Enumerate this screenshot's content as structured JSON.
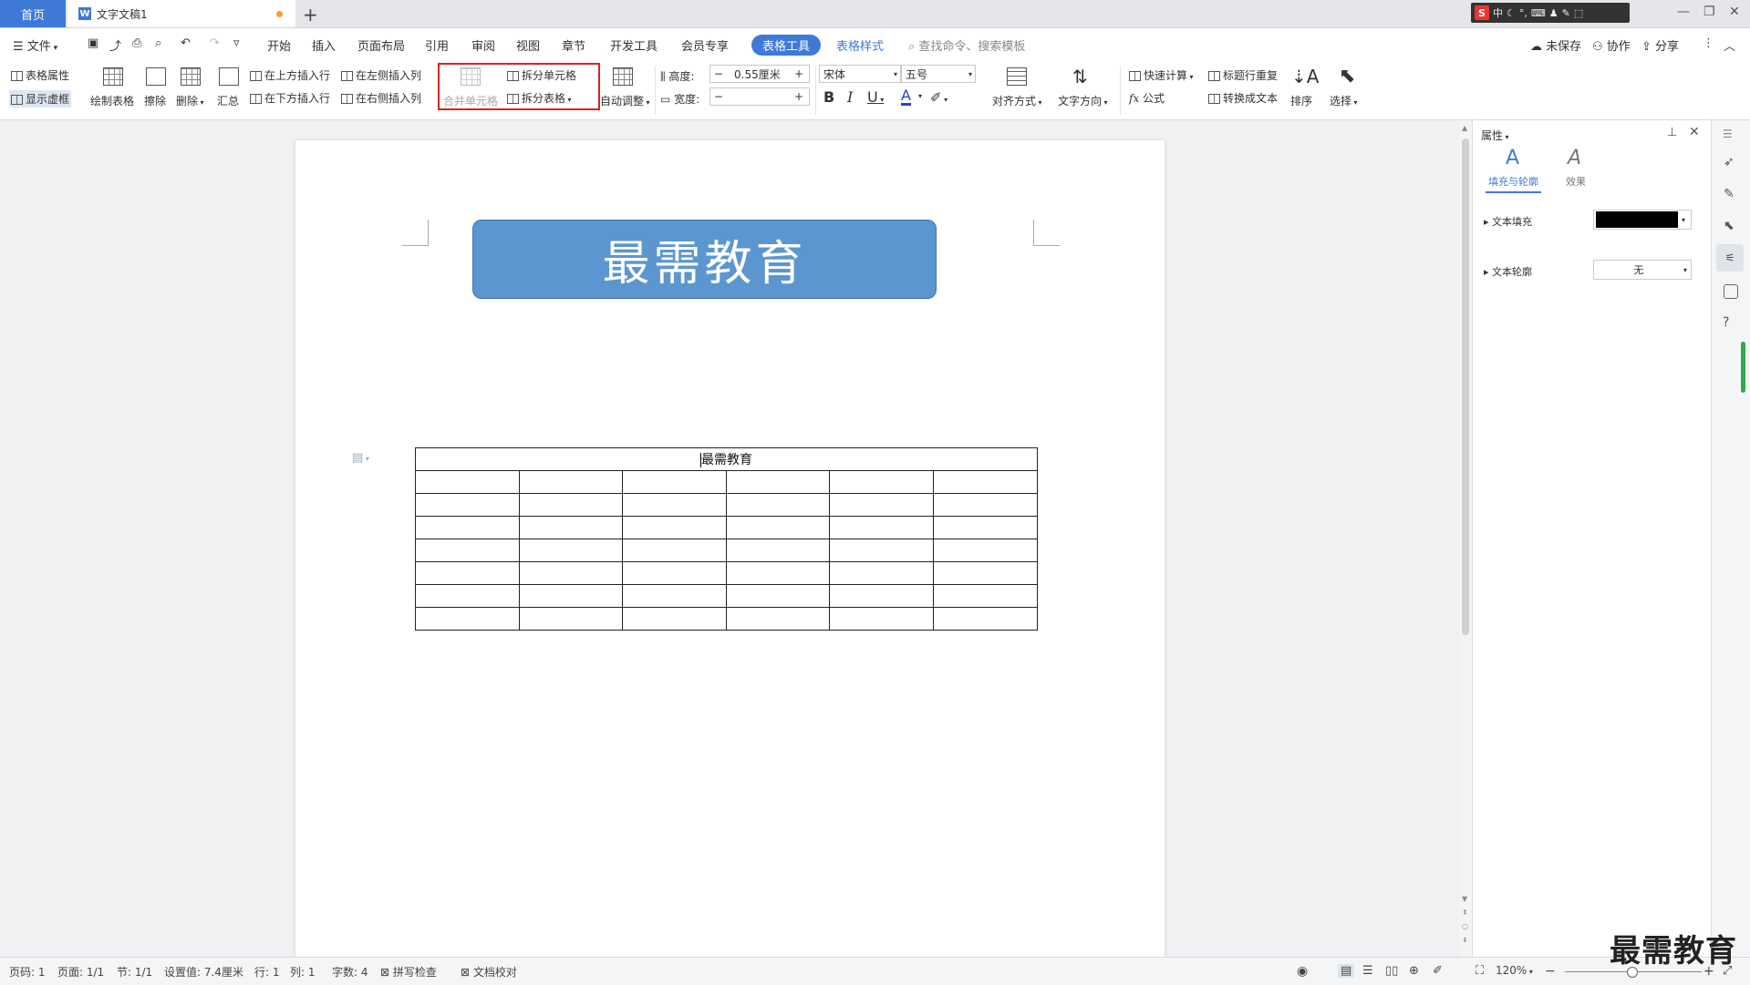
{
  "tabs": {
    "home": "首页",
    "doc_title": "文字文稿1",
    "new_tab": "+"
  },
  "ime": {
    "logo": "S",
    "mode": "中"
  },
  "window": {
    "minimize": "—",
    "restore": "❐",
    "close": "✕"
  },
  "menu": {
    "file": "文件",
    "items": [
      "开始",
      "插入",
      "页面布局",
      "引用",
      "审阅",
      "视图",
      "章节",
      "开发工具",
      "会员专享"
    ],
    "table_tools": "表格工具",
    "table_style": "表格样式",
    "search_placeholder": "查找命令、搜索模板",
    "unsaved": "未保存",
    "collab": "协作",
    "share": "分享"
  },
  "ribbon": {
    "table_props": "表格属性",
    "show_grid": "显示虚框",
    "draw_table": "绘制表格",
    "erase": "擦除",
    "delete": "删除",
    "summary": "汇总",
    "insert_above": "在上方插入行",
    "insert_below": "在下方插入行",
    "insert_left": "在左侧插入列",
    "insert_right": "在右侧插入列",
    "merge_cells": "合并单元格",
    "split_cells": "拆分单元格",
    "split_table": "拆分表格",
    "auto_adjust": "自动调整",
    "height_label": "高度:",
    "height_value": "0.55厘米",
    "width_label": "宽度:",
    "width_value": "",
    "font_name": "宋体",
    "font_size": "五号",
    "bold": "B",
    "italic": "I",
    "underline": "U",
    "font_color": "A",
    "align": "对齐方式",
    "text_dir": "文字方向",
    "quick_calc": "快速计算",
    "header_repeat": "标题行重复",
    "formula": "公式",
    "to_text": "转换成文本",
    "sort": "排序",
    "select": "选择"
  },
  "document": {
    "banner_text": "最需教育",
    "table_header": "最需教育",
    "rows": 7,
    "cols": 6
  },
  "panel": {
    "title": "属性",
    "tab_fill": "填充与轮廓",
    "tab_effect": "效果",
    "text_fill": "文本填充",
    "text_outline": "文本轮廓",
    "outline_value": "无",
    "fill_color": "#000000"
  },
  "status": {
    "page": "页码: 1",
    "pages": "页面: 1/1",
    "section": "节: 1/1",
    "setting": "设置值: 7.4厘米",
    "row": "行: 1",
    "col": "列: 1",
    "words": "字数: 4",
    "spell": "拼写检查",
    "proof": "文档校对",
    "zoom": "120%"
  },
  "watermark": "最需教育",
  "colors": {
    "accent": "#3f79d8",
    "banner": "#5b96d1",
    "highlight": "#e02020"
  }
}
